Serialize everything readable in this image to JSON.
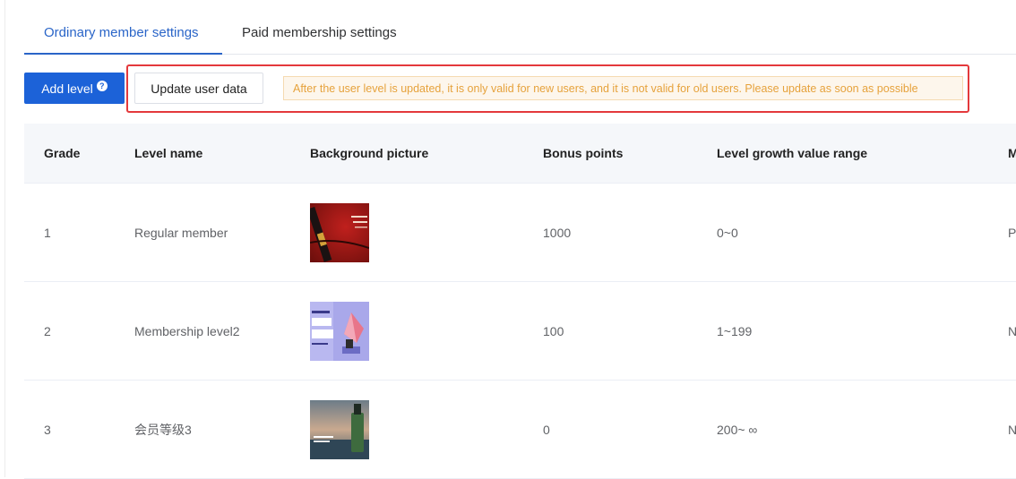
{
  "tabs": [
    {
      "label": "Ordinary member settings",
      "active": true
    },
    {
      "label": "Paid membership settings",
      "active": false
    }
  ],
  "toolbar": {
    "add_level_label": "Add level",
    "help_icon_glyph": "?",
    "update_label": "Update user data",
    "notice": "After the user level is updated, it is only valid for new users, and it is not valid for old users. Please update as soon as possible"
  },
  "colors": {
    "primary": "#1c62d8",
    "warning": "#e6a23c",
    "highlight": "#e4393c"
  },
  "table": {
    "columns": [
      "Grade",
      "Level name",
      "Background picture",
      "Bonus points",
      "Level growth value range",
      "M"
    ],
    "rows": [
      {
        "grade": "1",
        "name": "Regular member",
        "bonus": "1000",
        "range": "0~0",
        "extra": "P"
      },
      {
        "grade": "2",
        "name": "Membership level2",
        "bonus": "100",
        "range": "1~199",
        "extra": "N"
      },
      {
        "grade": "3",
        "name": "会员等级3",
        "bonus": "0",
        "range": "200~ ∞",
        "extra": "N"
      }
    ]
  }
}
